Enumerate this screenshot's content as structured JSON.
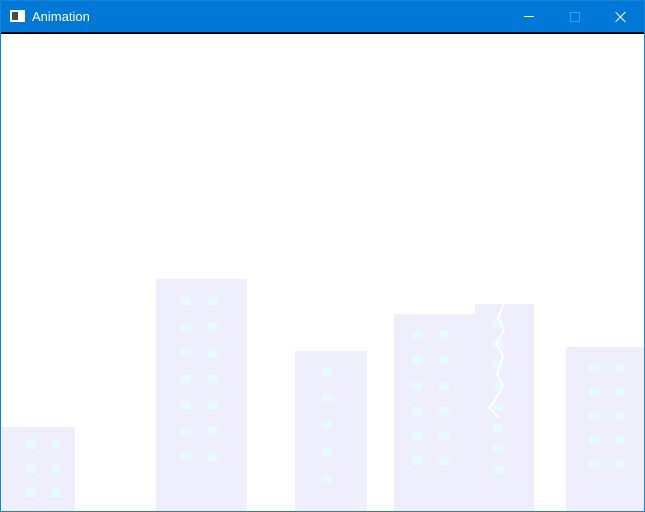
{
  "window": {
    "title": "Animation",
    "colors": {
      "titlebar": "#0078d7",
      "building": "#efeefc",
      "window_light": "#e6fbfb",
      "lightning": "#ffffff"
    }
  },
  "titlebar": {
    "app_icon": "app-window-icon",
    "buttons": {
      "minimize_icon": "minimize-icon",
      "maximize_icon": "maximize-icon",
      "close_icon": "close-icon"
    }
  }
}
